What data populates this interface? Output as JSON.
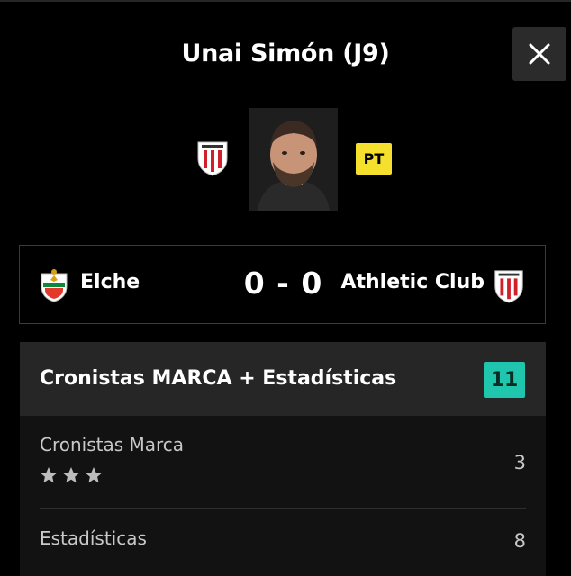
{
  "header": {
    "title": "Unai Simón (J9)",
    "close_icon": "close-icon"
  },
  "player": {
    "position_badge": "PT",
    "team_crest_icon": "athletic-club-crest",
    "photo_icon": "player-photo"
  },
  "match": {
    "home_team": "Elche",
    "away_team": "Athletic Club",
    "score": "0 - 0",
    "home_crest_icon": "elche-crest",
    "away_crest_icon": "athletic-club-crest"
  },
  "rating_panel": {
    "title": "Cronistas MARCA + Estadísticas",
    "total": "11",
    "total_badge_color": "#1fc6ad",
    "rows": [
      {
        "label": "Cronistas Marca",
        "value": "3",
        "stars": 3
      },
      {
        "label": "Estadísticas",
        "value": "8"
      }
    ]
  },
  "colors": {
    "background": "#000000",
    "position_badge": "#f5e02e"
  }
}
